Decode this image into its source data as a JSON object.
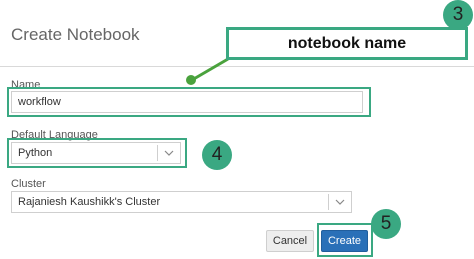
{
  "dialog": {
    "title": "Create Notebook",
    "name_label": "Name",
    "name_value": "workflow",
    "language_label": "Default Language",
    "language_value": "Python",
    "cluster_label": "Cluster",
    "cluster_value": "Rajaniesh Kaushikk's Cluster",
    "cancel_label": "Cancel",
    "create_label": "Create"
  },
  "annotations": {
    "callout_text": "notebook name",
    "step_name": "3",
    "step_language": "4",
    "step_create": "5",
    "accent_color": "#3aa882"
  },
  "icons": {
    "select_caret": "chevron-down-icon"
  }
}
